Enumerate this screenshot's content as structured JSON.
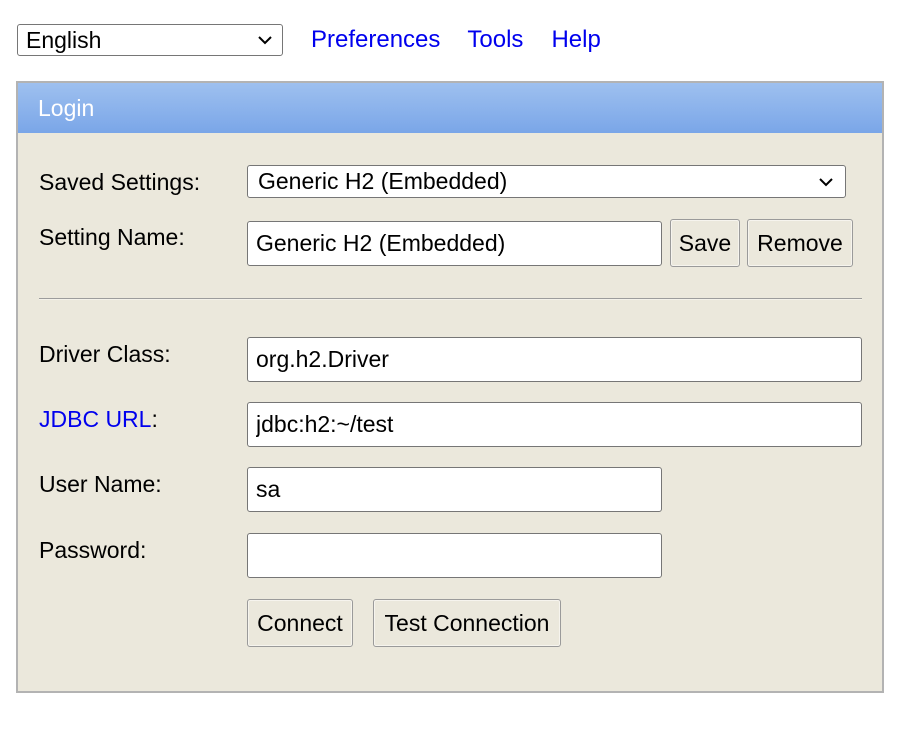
{
  "topbar": {
    "language": "English",
    "links": {
      "preferences": "Preferences",
      "tools": "Tools",
      "help": "Help"
    }
  },
  "login": {
    "title": "Login",
    "saved_settings": {
      "label": "Saved Settings:",
      "value": "Generic H2 (Embedded)"
    },
    "setting_name": {
      "label": "Setting Name:",
      "value": "Generic H2 (Embedded)",
      "save_label": "Save",
      "remove_label": "Remove"
    },
    "driver_class": {
      "label": "Driver Class:",
      "value": "org.h2.Driver"
    },
    "jdbc_url": {
      "link_label": "JDBC URL",
      "suffix": ":",
      "value": "jdbc:h2:~/test"
    },
    "user_name": {
      "label": "User Name:",
      "value": "sa"
    },
    "password": {
      "label": "Password:",
      "value": ""
    },
    "buttons": {
      "connect": "Connect",
      "test_connection": "Test Connection"
    }
  },
  "colors": {
    "header_gradient_top": "#9ec0ef",
    "header_gradient_bottom": "#7aa6e8",
    "panel_background": "#ebe8dc",
    "link": "#0000ee"
  },
  "icons": {
    "dropdown": "chevron-down-icon"
  }
}
